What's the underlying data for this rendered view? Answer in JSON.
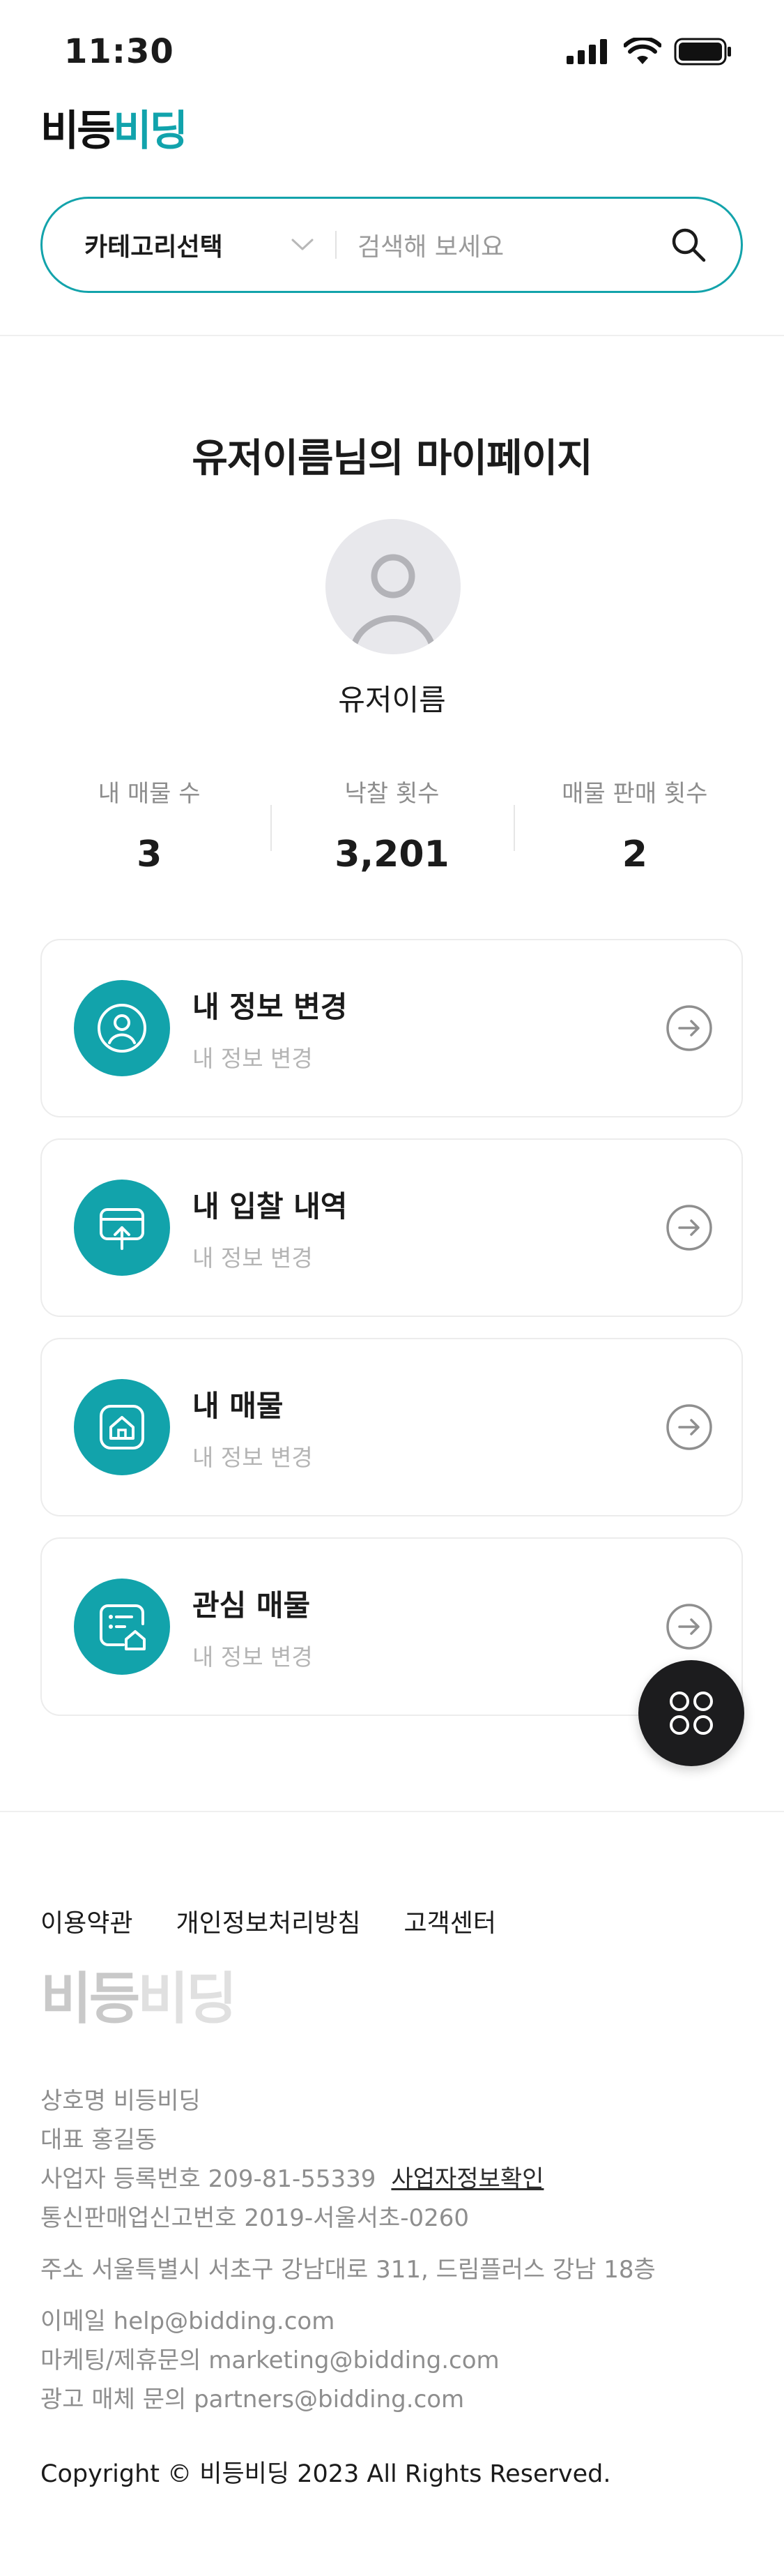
{
  "status_bar": {
    "time": "11:30"
  },
  "logo": {
    "part1": "비등",
    "part2": "비딩"
  },
  "search": {
    "category": "카테고리선택",
    "placeholder": "검색해 보세요"
  },
  "page": {
    "title": "유저이름님의 마이페이지",
    "username": "유저이름"
  },
  "stats": [
    {
      "label": "내 매물 수",
      "value": "3"
    },
    {
      "label": "낙찰 횟수",
      "value": "3,201"
    },
    {
      "label": "매물 판매 횟수",
      "value": "2"
    }
  ],
  "menu": [
    {
      "title": "내 정보 변경",
      "subtitle": "내 정보 변경",
      "icon": "user-icon"
    },
    {
      "title": "내 입찰 내역",
      "subtitle": "내 정보 변경",
      "icon": "bid-upload-icon"
    },
    {
      "title": "내 매물",
      "subtitle": "내 정보 변경",
      "icon": "house-icon"
    },
    {
      "title": "관심 매물",
      "subtitle": "내 정보 변경",
      "icon": "favorite-property-icon"
    }
  ],
  "footer": {
    "links": [
      "이용약관",
      "개인정보처리방침",
      "고객센터"
    ],
    "logo": {
      "part1": "비등",
      "part2": "비딩"
    },
    "company": "상호명 비등비딩",
    "ceo": "대표 홍길동",
    "biz_reg": "사업자 등록번호 209-81-55339",
    "biz_link": "사업자정보확인",
    "ecommerce": "통신판매업신고번호 2019-서울서초-0260",
    "address": "주소 서울특별시 서초구 강남대로 311, 드림플러스 강남 18층",
    "email": "이메일 help@bidding.com",
    "marketing": "마케팅/제휴문의 marketing@bidding.com",
    "ads": "광고 매체 문의 partners@bidding.com",
    "copyright": "Copyright © 비등비딩 2023 All Rights Reserved."
  },
  "colors": {
    "accent": "#12a3ab",
    "fab": "#1c1c1e"
  }
}
